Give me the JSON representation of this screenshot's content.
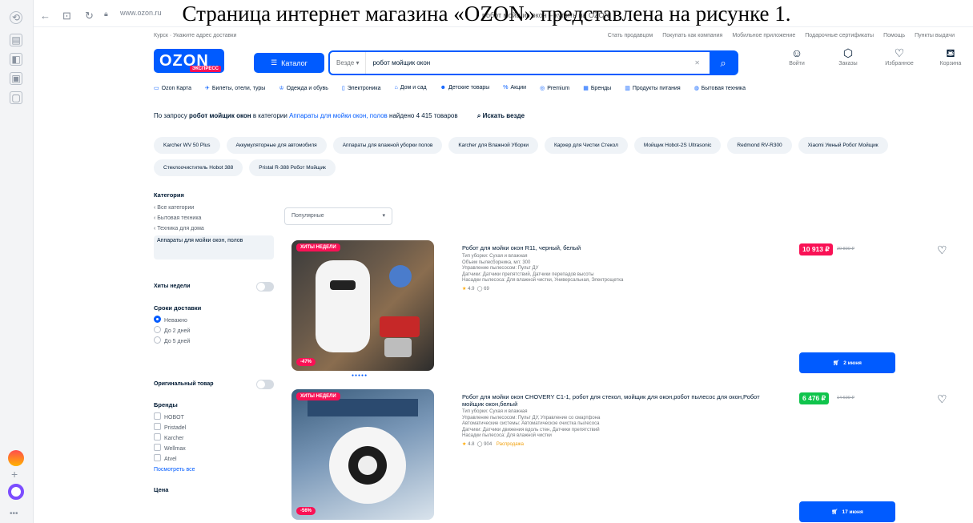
{
  "caption": "Страница интернет магазина «OZON» представлена на рисунке 1.",
  "browser": {
    "address": "www.ozon.ru",
    "tab_title": "робот мойщик окон – купить на OZON"
  },
  "topline": {
    "location": "Курск · Укажите адрес доставки",
    "links": [
      "Стать продавцом",
      "Покупать как компания",
      "Мобильное приложение",
      "Подарочные сертификаты",
      "Помощь",
      "Пункты выдачи"
    ]
  },
  "header": {
    "logo": "OZON",
    "logo_badge": "ЭКСПРЕСС",
    "catalog_label": "Каталог",
    "search_scope": "Везде",
    "search_query": "робот мойщик окон",
    "icons": [
      {
        "label": "Войти",
        "icon": "user-icon"
      },
      {
        "label": "Заказы",
        "icon": "box-icon"
      },
      {
        "label": "Избранное",
        "icon": "heart-icon"
      },
      {
        "label": "Корзина",
        "icon": "cart-icon"
      }
    ]
  },
  "menu": [
    "Ozon Карта",
    "Билеты, отели, туры",
    "Одежда и обувь",
    "Электроника",
    "Дом и сад",
    "Детские товары",
    "Акции",
    "Premium",
    "Бренды",
    "Продукты питания",
    "Бытовая техника"
  ],
  "result": {
    "prefix": "По запросу",
    "query": "робот мойщик окон",
    "in_cat": "в категории",
    "category": "Аппараты для мойки окон, полов",
    "found": "найдено 4 415 товаров",
    "search_all": "Искать везде"
  },
  "chips": [
    "Karcher WV 50 Plus",
    "Аккумуляторные для автомобиля",
    "Аппараты для влажной уборки полов",
    "Karcher для Влажной Уборки",
    "Кархер для Чистки Стекол",
    "Мойщик Hobot-2S Ultrasonic",
    "Redmond RV-R300",
    "Xiaomi Умный Робот Мойщик",
    "Стеклоочиститель Hobot 388",
    "Pristal R-388 Робот Мойщик"
  ],
  "sidebar": {
    "categories_heading": "Категория",
    "categories": [
      "Все категории",
      "Бытовая техника",
      "Техника для дома"
    ],
    "active_category": "Аппараты для мойки окон, полов",
    "hits_label": "Хиты недели",
    "delivery_heading": "Сроки доставки",
    "delivery_options": [
      "Неважно",
      "До 2 дней",
      "До 5 дней"
    ],
    "original_label": "Оригинальный товар",
    "brands_heading": "Бренды",
    "brands": [
      "HOBOT",
      "Pristadel",
      "Karcher",
      "Wellmax",
      "Atvel"
    ],
    "brands_more": "Посмотреть все",
    "price_heading": "Цена"
  },
  "sort": {
    "selected": "Популярные"
  },
  "products": [
    {
      "badge": "ХИТЫ НЕДЕЛИ",
      "discount": "-47%",
      "title": "Робот для мойки окон R11, черный, белый",
      "props": [
        "Тип уборки: Сухая и влажная",
        "Объем пылесборника, мл: 300",
        "Управление пылесосом: Пульт ДУ",
        "Датчики: Датчики препятствий, Датчики перепадов высоты",
        "Насадки пылесоса: Для влажной чистки, Универсальная, Электрощетка"
      ],
      "rating": "4.9",
      "reviews": "69",
      "promo": "",
      "price": "10 913 ₽",
      "old_price": "20 890 ₽",
      "price_color": "#f91155",
      "cart": "2 июня"
    },
    {
      "badge": "ХИТЫ НЕДЕЛИ",
      "discount": "-56%",
      "title": "Робот для мойки окон CHOVERY C1-1, робот для стекол, мойщик для окон,робот пылесос для окон,Робот мойщик окон,белый",
      "props": [
        "Тип уборки: Сухая и влажная",
        "Управление пылесосом: Пульт ДУ, Управление со смартфона",
        "Автоматические системы: Автоматическое очистка пылесоса",
        "Датчики: Датчики движения вдоль стен, Датчики препятствий",
        "Насадки пылесоса: Для влажной чистки"
      ],
      "rating": "4.8",
      "reviews": "904",
      "promo": "Распродажа",
      "price": "6 476 ₽",
      "old_price": "14 699 ₽",
      "price_color": "#10c44c",
      "cart": "17 июня"
    }
  ]
}
